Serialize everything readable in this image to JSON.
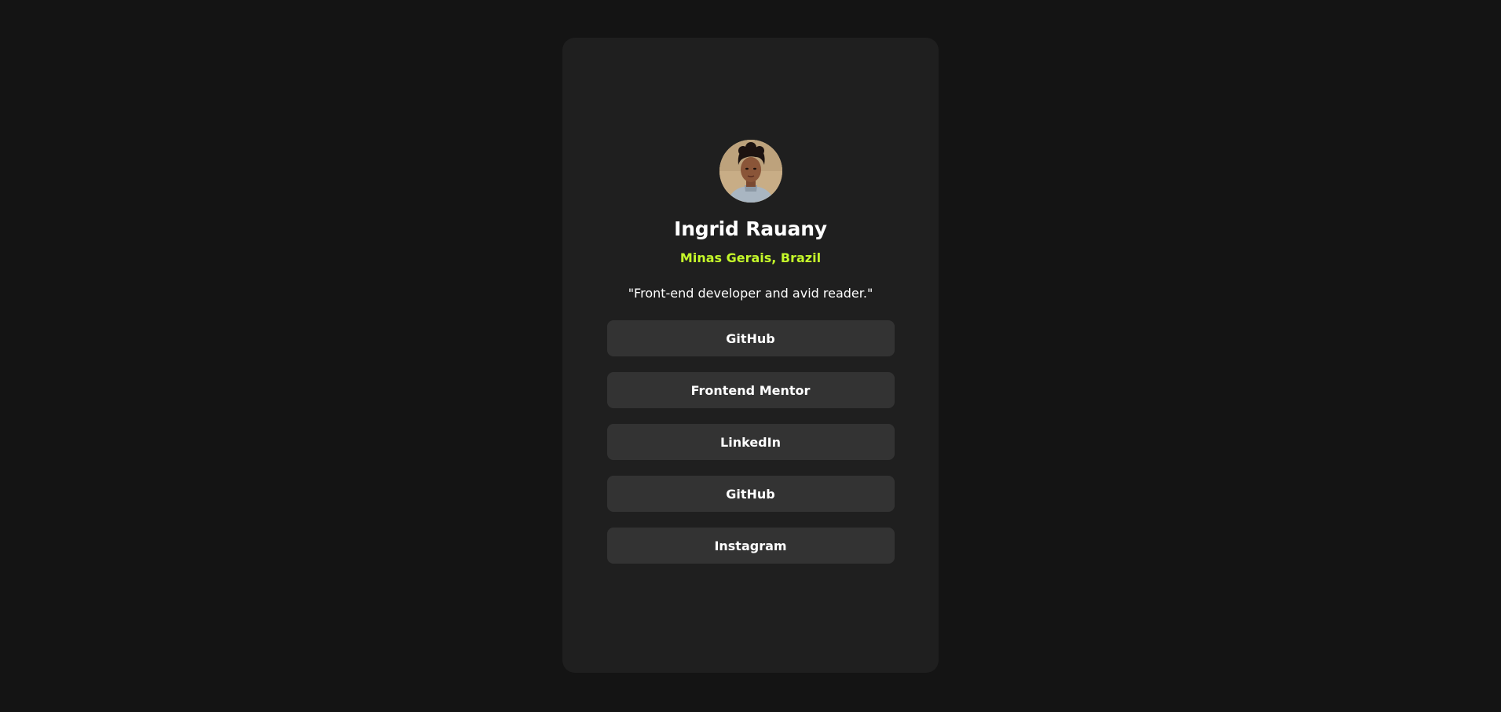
{
  "profile": {
    "name": "Ingrid Rauany",
    "location": "Minas Gerais, Brazil",
    "bio": "\"Front-end developer and avid reader.\""
  },
  "links": [
    {
      "label": "GitHub"
    },
    {
      "label": "Frontend Mentor"
    },
    {
      "label": "LinkedIn"
    },
    {
      "label": "GitHub"
    },
    {
      "label": "Instagram"
    }
  ],
  "colors": {
    "background": "#141414",
    "card": "#1f1f1f",
    "button": "#333333",
    "accent": "#c4f82a",
    "text": "#ffffff"
  }
}
